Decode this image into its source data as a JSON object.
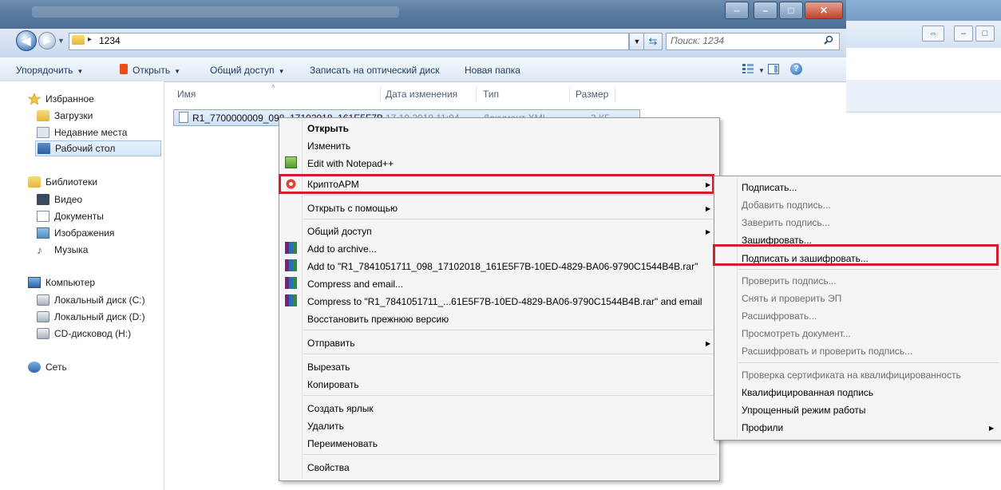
{
  "window": {
    "address_path": "1234",
    "search_placeholder": "Поиск: 1234"
  },
  "toolbar": {
    "organize": "Упорядочить",
    "open": "Открыть",
    "share": "Общий доступ",
    "burn": "Записать на оптический диск",
    "new_folder": "Новая папка"
  },
  "nav": {
    "favorites": "Избранное",
    "downloads": "Загрузки",
    "recent": "Недавние места",
    "desktop": "Рабочий стол",
    "libraries": "Библиотеки",
    "video": "Видео",
    "documents": "Документы",
    "images": "Изображения",
    "music": "Музыка",
    "computer": "Компьютер",
    "disk_c": "Локальный диск (C:)",
    "disk_d": "Локальный диск (D:)",
    "cd": "CD-дисковод (H:)",
    "network": "Сеть"
  },
  "columns": {
    "name": "Имя",
    "date": "Дата изменения",
    "type": "Тип",
    "size": "Размер"
  },
  "file": {
    "name": "R1_7700000009_098_17102018_161E5F7B",
    "date": "17.10.2018 11:04",
    "type": "Документ XML",
    "size": "3 КБ"
  },
  "context_menu": {
    "open": "Открыть",
    "edit": "Изменить",
    "notepad": "Edit with Notepad++",
    "cryptoarm": "КриптоАРМ",
    "open_with": "Открыть с помощью",
    "share": "Общий доступ",
    "add_archive": "Add to archive...",
    "add_to_rar": "Add to \"R1_7841051711_098_17102018_161E5F7B-10ED-4829-BA06-9790C1544B4B.rar\"",
    "compress_email": "Compress and email...",
    "compress_to_rar_email": "Compress to \"R1_7841051711_...61E5F7B-10ED-4829-BA06-9790C1544B4B.rar\" and email",
    "restore": "Восстановить прежнюю версию",
    "send_to": "Отправить",
    "cut": "Вырезать",
    "copy": "Копировать",
    "shortcut": "Создать ярлык",
    "delete": "Удалить",
    "rename": "Переименовать",
    "properties": "Свойства"
  },
  "submenu": {
    "sign": "Подписать...",
    "add_sign": "Добавить подпись...",
    "certify": "Заверить подпись...",
    "encrypt": "Зашифровать...",
    "sign_encrypt": "Подписать и зашифровать...",
    "verify": "Проверить подпись...",
    "remove_verify": "Снять и проверить ЭП",
    "decrypt": "Расшифровать...",
    "view_doc": "Просмотреть документ...",
    "decrypt_verify": "Расшифровать и проверить подпись...",
    "check_cert": "Проверка сертификата на квалифицированность",
    "qualified": "Квалифицированная подпись",
    "simple_mode": "Упрощенный режим работы",
    "profiles": "Профили"
  },
  "colors": {
    "highlight_border": "#d0202d",
    "window_title": "#5a7ca1"
  }
}
